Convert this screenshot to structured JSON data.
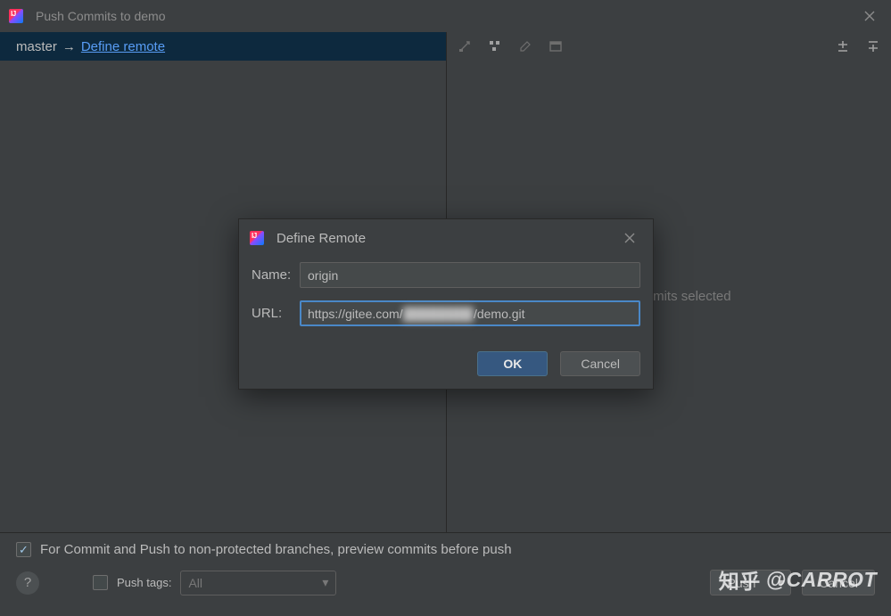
{
  "window": {
    "title": "Push Commits to demo"
  },
  "branch": {
    "local": "master",
    "define_remote_link": "Define remote"
  },
  "right": {
    "empty": "No commits selected"
  },
  "modal": {
    "title": "Define Remote",
    "name_label": "Name:",
    "name_value": "origin",
    "url_label": "URL:",
    "url_prefix": "https://gitee.com/",
    "url_blurred": "████████",
    "url_suffix": "/demo.git",
    "ok": "OK",
    "cancel": "Cancel"
  },
  "footer": {
    "preview_label": "For Commit and Push to non-protected branches, preview commits before push",
    "push_tags_label": "Push tags:",
    "tags_option": "All",
    "push": "Push",
    "cancel": "Cancel"
  },
  "watermark": {
    "zhihu": "知乎",
    "handle": "@CARROT"
  }
}
